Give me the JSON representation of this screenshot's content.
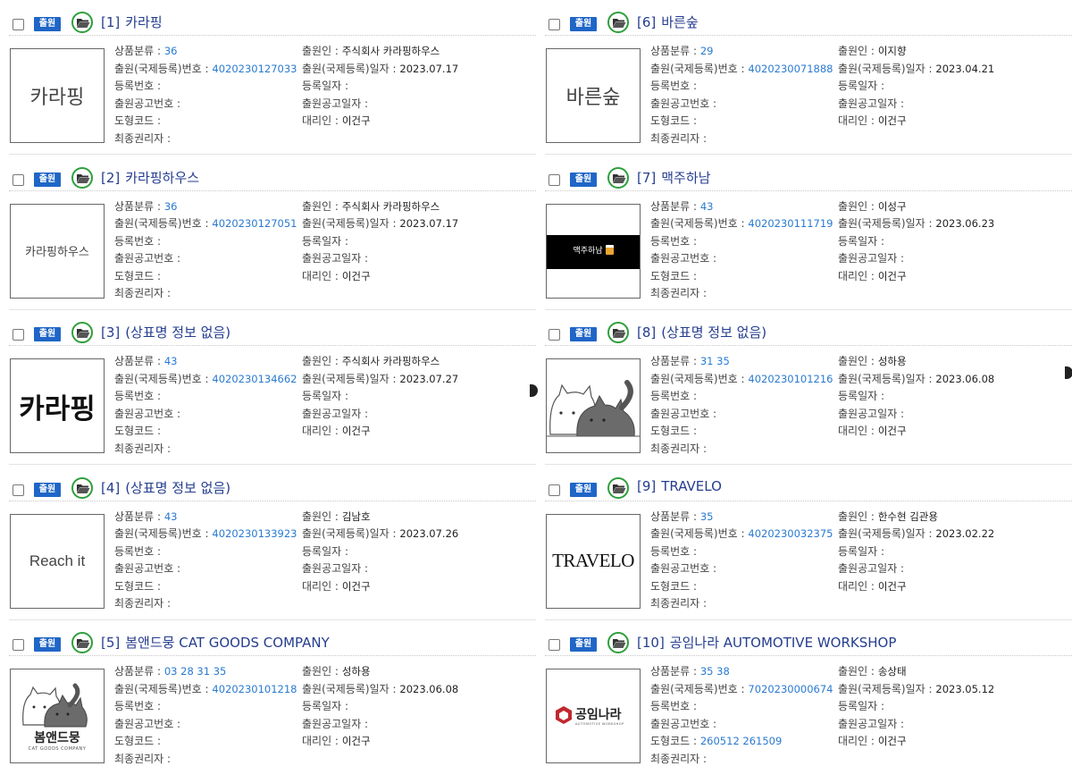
{
  "labels": {
    "category": "상품분류 :",
    "applicant": "출원인 :",
    "app_no": "출원(국제등록)번호 :",
    "app_date": "출원(국제등록)일자 :",
    "reg_no": "등록번호 :",
    "reg_date": "등록일자 :",
    "pub_no": "출원공고번호 :",
    "pub_date": "출원공고일자 :",
    "design_code": "도형코드 :",
    "agent": "대리인 :",
    "final_owner": "최종권리자 :"
  },
  "badge_label": "출원",
  "icons": {
    "folder": "open-folder-icon",
    "checkbox": "checkbox-icon"
  },
  "colors": {
    "badge": "#1f66c7",
    "title": "#253d8f",
    "link": "#2a7ad1",
    "folder_ring": "#2e9f3b"
  },
  "items": [
    {
      "num": "[1]",
      "title": "카라핑",
      "category": "36",
      "applicant": "주식회사 카라핑하우스",
      "app_no": "4020230127033",
      "app_date": "2023.07.17",
      "reg_no": "",
      "reg_date": "",
      "pub_no": "",
      "pub_date": "",
      "design_code": "",
      "agent": "이건구",
      "final_owner": "",
      "image_text": "카라핑"
    },
    {
      "num": "[2]",
      "title": "카라핑하우스",
      "category": "36",
      "applicant": "주식회사 카라핑하우스",
      "app_no": "4020230127051",
      "app_date": "2023.07.17",
      "reg_no": "",
      "reg_date": "",
      "pub_no": "",
      "pub_date": "",
      "design_code": "",
      "agent": "이건구",
      "final_owner": "",
      "image_text": "카라핑하우스"
    },
    {
      "num": "[3]",
      "title": "(상표명 정보 없음)",
      "category": "43",
      "applicant": "주식회사 카라핑하우스",
      "app_no": "4020230134662",
      "app_date": "2023.07.27",
      "reg_no": "",
      "reg_date": "",
      "pub_no": "",
      "pub_date": "",
      "design_code": "",
      "agent": "이건구",
      "final_owner": "",
      "image_text": "카라핑"
    },
    {
      "num": "[4]",
      "title": "(상표명 정보 없음)",
      "category": "43",
      "applicant": "김남호",
      "app_no": "4020230133923",
      "app_date": "2023.07.26",
      "reg_no": "",
      "reg_date": "",
      "pub_no": "",
      "pub_date": "",
      "design_code": "",
      "agent": "이건구",
      "final_owner": "",
      "image_text": "Reach it"
    },
    {
      "num": "[5]",
      "title": "봄앤드뭉 CAT GOODS COMPANY",
      "category": "03 28 31 35",
      "applicant": "성하용",
      "app_no": "4020230101218",
      "app_date": "2023.06.08",
      "reg_no": "",
      "reg_date": "",
      "pub_no": "",
      "pub_date": "",
      "design_code": "",
      "agent": "이건구",
      "final_owner": "",
      "image_text": "봄앤드뭉",
      "image_subtext": "CAT GOODS COMPANY"
    },
    {
      "num": "[6]",
      "title": "바른숲",
      "category": "29",
      "applicant": "이지향",
      "app_no": "4020230071888",
      "app_date": "2023.04.21",
      "reg_no": "",
      "reg_date": "",
      "pub_no": "",
      "pub_date": "",
      "design_code": "",
      "agent": "이건구",
      "final_owner": "",
      "image_text": "바른숲"
    },
    {
      "num": "[7]",
      "title": "맥주하남",
      "category": "43",
      "applicant": "이성구",
      "app_no": "4020230111719",
      "app_date": "2023.06.23",
      "reg_no": "",
      "reg_date": "",
      "pub_no": "",
      "pub_date": "",
      "design_code": "",
      "agent": "이건구",
      "final_owner": "",
      "image_text": "맥주하남"
    },
    {
      "num": "[8]",
      "title": "(상표명 정보 없음)",
      "category": "31 35",
      "applicant": "성하용",
      "app_no": "4020230101216",
      "app_date": "2023.06.08",
      "reg_no": "",
      "reg_date": "",
      "pub_no": "",
      "pub_date": "",
      "design_code": "",
      "agent": "이건구",
      "final_owner": "",
      "image_text": ""
    },
    {
      "num": "[9]",
      "title": "TRAVELO",
      "category": "35",
      "applicant": "한수현 김관용",
      "app_no": "4020230032375",
      "app_date": "2023.02.22",
      "reg_no": "",
      "reg_date": "",
      "pub_no": "",
      "pub_date": "",
      "design_code": "",
      "agent": "이건구",
      "final_owner": "",
      "image_text": "TRAVELO"
    },
    {
      "num": "[10]",
      "title": "공임나라 AUTOMOTIVE WORKSHOP",
      "category": "35 38",
      "applicant": "송상태",
      "app_no": "7020230000674",
      "app_date": "2023.05.12",
      "reg_no": "",
      "reg_date": "",
      "pub_no": "",
      "pub_date": "",
      "design_code": "260512 261509",
      "agent": "이건구",
      "final_owner": "",
      "image_text": "공임나라",
      "image_subtext": "AUTOMOTIVE WORKSHOP"
    }
  ]
}
